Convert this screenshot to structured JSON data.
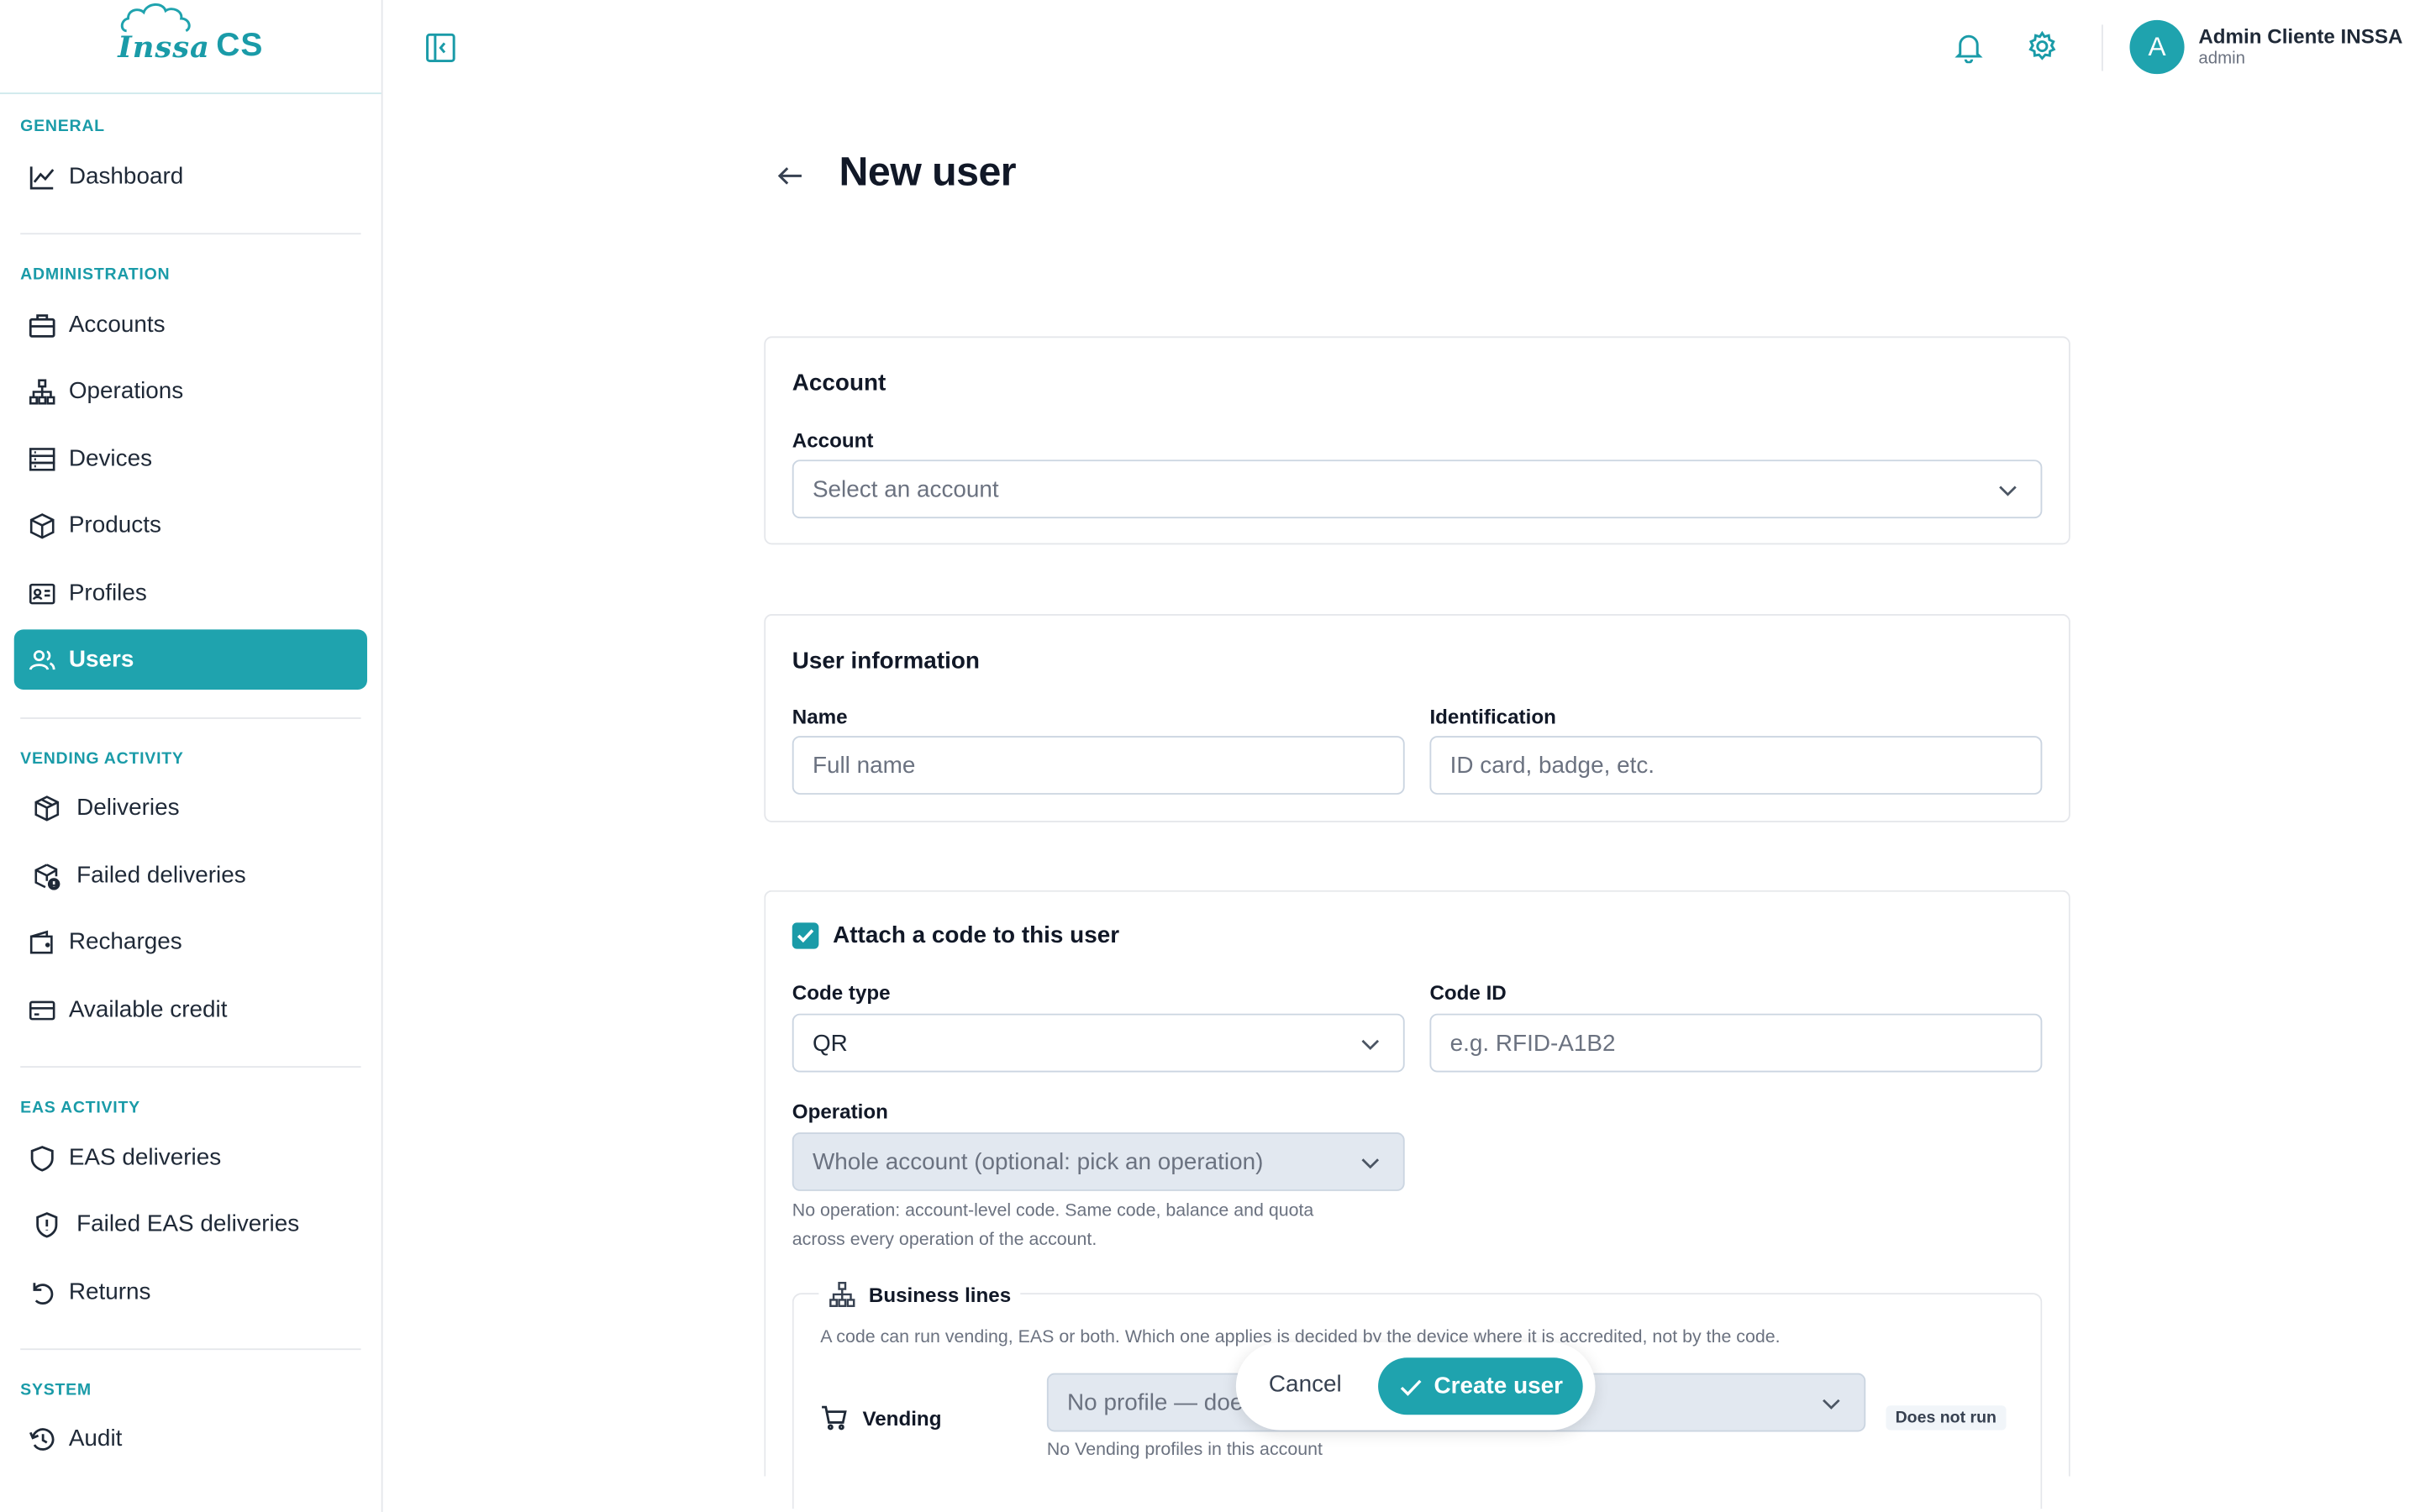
{
  "brand": {
    "logo_text_1": "Inssa",
    "logo_text_2": "CS",
    "accent_color": "#1fa3ae"
  },
  "sidebar": {
    "sections": {
      "general": "GENERAL",
      "administration": "ADMINISTRATION",
      "vending": "VENDING ACTIVITY",
      "eas": "EAS ACTIVITY",
      "system": "SYSTEM"
    },
    "items": [
      {
        "label": "Dashboard",
        "icon": "chart-line-icon"
      },
      {
        "label": "Accounts",
        "icon": "briefcase-icon"
      },
      {
        "label": "Operations",
        "icon": "hierarchy-icon"
      },
      {
        "label": "Devices",
        "icon": "server-icon"
      },
      {
        "label": "Products",
        "icon": "box-icon"
      },
      {
        "label": "Profiles",
        "icon": "id-card-icon"
      },
      {
        "label": "Users",
        "icon": "users-icon",
        "active": true
      },
      {
        "label": "Deliveries",
        "icon": "package-icon"
      },
      {
        "label": "Failed deliveries",
        "icon": "package-alert-icon"
      },
      {
        "label": "Recharges",
        "icon": "wallet-icon"
      },
      {
        "label": "Available credit",
        "icon": "credit-card-icon"
      },
      {
        "label": "EAS deliveries",
        "icon": "shield-icon"
      },
      {
        "label": "Failed EAS deliveries",
        "icon": "shield-alert-icon"
      },
      {
        "label": "Returns",
        "icon": "rotate-ccw-icon"
      },
      {
        "label": "Audit",
        "icon": "history-icon"
      }
    ]
  },
  "header": {
    "user_name": "Admin Cliente INSSA",
    "user_role": "admin",
    "avatar_initial": "A"
  },
  "page": {
    "title": "New user"
  },
  "account_card": {
    "title": "Account",
    "account_label": "Account",
    "account_placeholder": "Select an account"
  },
  "user_info_card": {
    "title": "User information",
    "name_label": "Name",
    "name_placeholder": "Full name",
    "identification_label": "Identification",
    "identification_placeholder": "ID card, badge, etc."
  },
  "code_card": {
    "attach_label": "Attach a code to this user",
    "attach_checked": true,
    "code_type_label": "Code type",
    "code_type_value": "QR",
    "code_id_label": "Code ID",
    "code_id_placeholder": "e.g. RFID-A1B2",
    "operation_label": "Operation",
    "operation_value": "Whole account (optional: pick an operation)",
    "operation_help_1": "No operation: account-level code. Same code, balance and quota",
    "operation_help_2": "across every operation of the account.",
    "business_lines_title": "Business lines",
    "business_lines_help": "A code can run vending, EAS or both. Which one applies is decided by the device where it is accredited, not by the code.",
    "vending_label": "Vending",
    "vending_profile_value": "No profile — does not run",
    "vending_badge": "Does not run",
    "vending_help": "No Vending profiles in this account"
  },
  "actions": {
    "cancel_label": "Cancel",
    "create_label": "Create user"
  }
}
